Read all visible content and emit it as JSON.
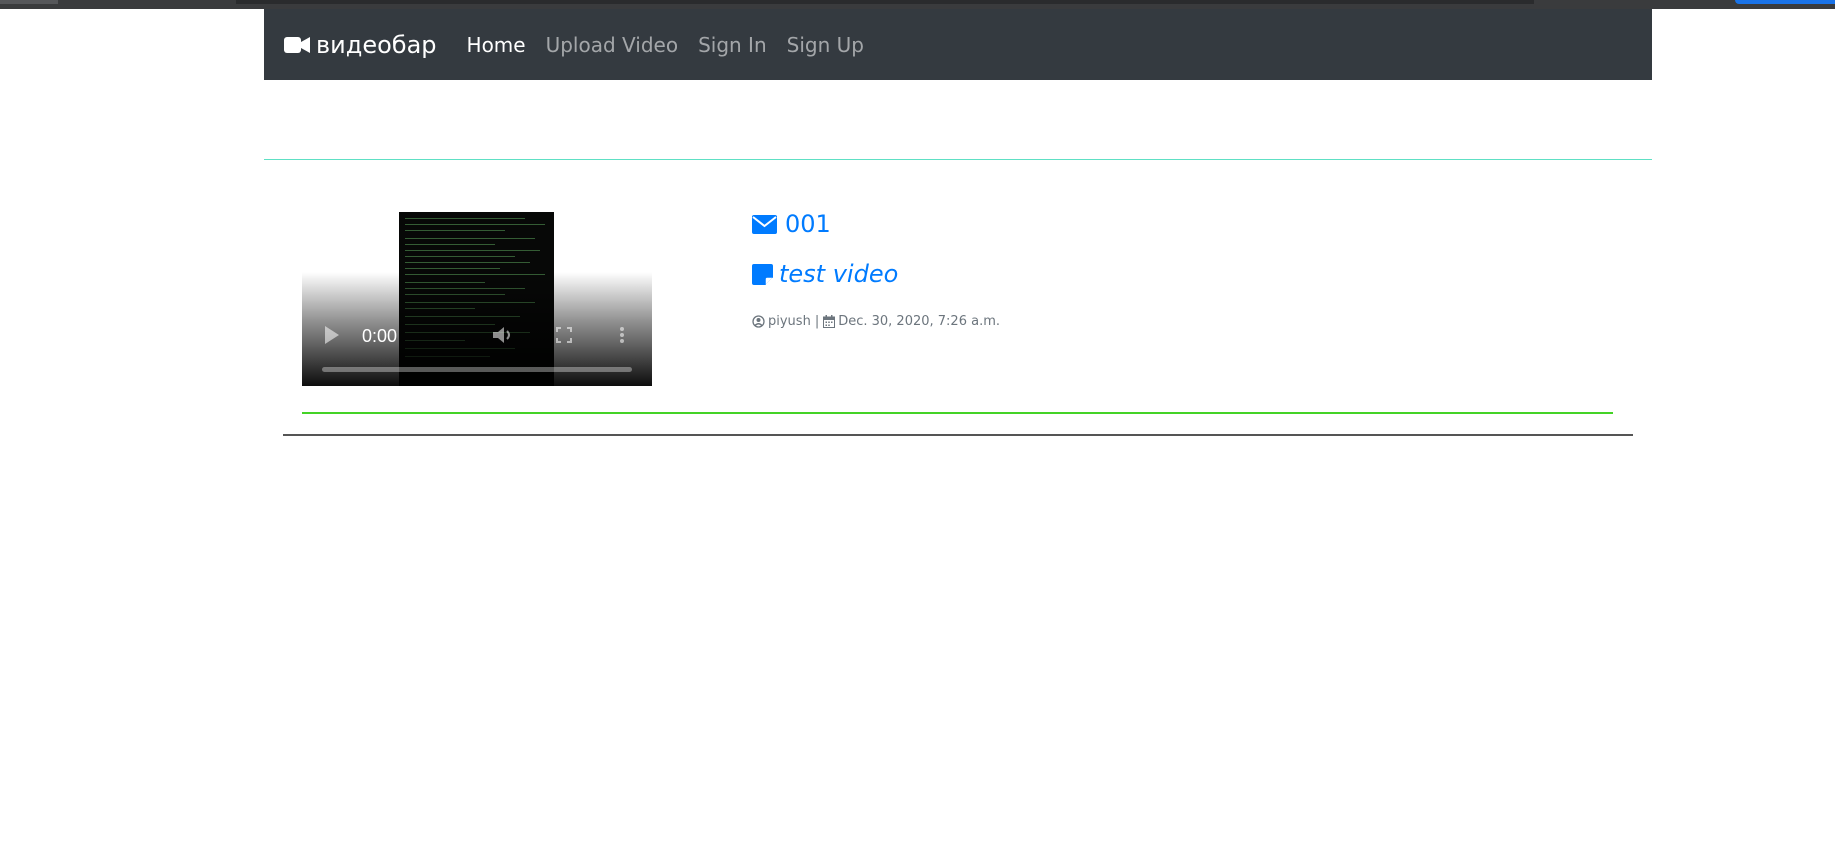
{
  "navbar": {
    "brand_text": "видеобар",
    "links": [
      {
        "label": "Home",
        "active": true
      },
      {
        "label": "Upload Video",
        "active": false
      },
      {
        "label": "Sign In",
        "active": false
      },
      {
        "label": "Sign Up",
        "active": false
      }
    ],
    "background": "#343a40"
  },
  "video": {
    "time": "0:00"
  },
  "entry": {
    "title": "001",
    "description": "test video",
    "author": "piyush",
    "separator": "|",
    "date": "Dec. 30, 2020, 7:26 a.m."
  },
  "colors": {
    "accent": "#007bff",
    "muted": "#6c757d",
    "divider_teal": "#5ee0c4",
    "divider_green": "#44d326"
  }
}
